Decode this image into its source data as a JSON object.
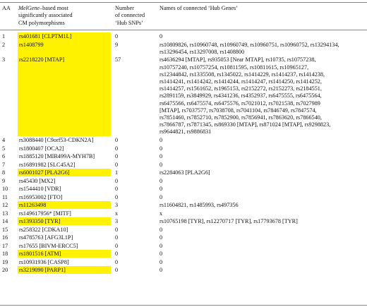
{
  "header": {
    "col_aa": "AA",
    "col_snp_em": "MelGene",
    "col_snp_rest1": "–based most",
    "col_snp_line2": "significantly associated",
    "col_snp_line3": "CM polymorphisms",
    "col_num_line1": "Number",
    "col_num_line2": "of connected",
    "col_num_line3": "‘Hub SNPs’",
    "col_names": "Names of connected ‘Hub Genes’"
  },
  "colors": {
    "highlight": "#fff200",
    "rule": "#888888"
  },
  "rows": [
    {
      "aa": "1",
      "snp": "rs401681 [CLPTM1L]",
      "highlight": true,
      "count": "0",
      "names": [
        "0"
      ]
    },
    {
      "aa": "2",
      "snp": "rs1408799",
      "highlight": true,
      "count": "9",
      "names": [
        "rs10809826, rs10960748, rs10960749, rs10960751, rs10960752, rs13294134,",
        "rs13296454, rs13297008, rs1408800"
      ]
    },
    {
      "aa": "3",
      "snp": "rs2218220 [MTAP]",
      "highlight": true,
      "count": "57",
      "names": [
        "rs4636294 [MTAP], rs935053 [Near MTAP], rs10735, rs10757238,",
        "rs10757240, rs10757254, rs10811595, rs10811615, rs10965127,",
        "rs12344842, rs1335508, rs1345022, rs1414229, rs1414237, rs1414238,",
        "rs1414241, rs1414242, rs1414244, rs1414247, rs1414250, rs1414252,",
        "rs1414257, rs1561652, rs1965153, rs2152272, rs2152273, rs2184551,",
        "rs2891159, rs3849929, rs4341236, rs4352937, rs6475555, rs6475564,",
        "rs6475566, rs6475574, rs6475576, rs7021012, rs7021538, rs7027989",
        "[MTAP], rs7037577, rs7038708, rs7041104, rs7846749, rs7847574,",
        "rs7851460, rs7852710, rs7852900, rs7856941, rs7863620, rs7866540,",
        "rs7866787, rs7871345, rs869330 [MTAP], rs871024 [MTAP], rs9298823,",
        "rs9644821, rs9886831"
      ]
    },
    {
      "aa": "4",
      "snp": "rs3088440 [C9orf53-CDKN2A]",
      "highlight": false,
      "count": "0",
      "names": [
        "0"
      ]
    },
    {
      "aa": "5",
      "snp": "rs1800407 [OCA2]",
      "highlight": false,
      "count": "0",
      "names": [
        "0"
      ]
    },
    {
      "aa": "6",
      "snp": "rs1885120 [MIR499A-MYH7B]",
      "highlight": false,
      "count": "0",
      "names": [
        "0"
      ]
    },
    {
      "aa": "7",
      "snp": "rs16891982 [SLC45A2]",
      "highlight": false,
      "count": "0",
      "names": [
        "0"
      ]
    },
    {
      "aa": "8",
      "snp": "rs6001027 [PLA2G6]",
      "highlight": true,
      "count": "1",
      "names": [
        "rs2284063 [PLA2G6]"
      ]
    },
    {
      "aa": "9",
      "snp": "rs45430 [MX2]",
      "highlight": false,
      "count": "0",
      "names": [
        "0"
      ]
    },
    {
      "aa": "10",
      "snp": "rs1544410 [VDR]",
      "highlight": false,
      "count": "0",
      "names": [
        "0"
      ]
    },
    {
      "aa": "11",
      "snp": "rs16953002 [FTO]",
      "highlight": false,
      "count": "0",
      "names": [
        "0"
      ]
    },
    {
      "aa": "12",
      "snp": "rs11263498",
      "highlight": true,
      "count": "3",
      "names": [
        "rs11604821, rs1485993, rs497356"
      ]
    },
    {
      "aa": "13",
      "snp": "rs149617956* [MITF]",
      "highlight": false,
      "count": "x",
      "names": [
        "x"
      ]
    },
    {
      "aa": "14",
      "snp": "rs1393350 [TYR]",
      "highlight": true,
      "count": "3",
      "names": [
        "rs10765198 [TYR], rs12270717 [TYR], rs17793678 [TYR]"
      ]
    },
    {
      "aa": "15",
      "snp": "rs258322 [CDKA10]",
      "highlight": false,
      "count": "0",
      "names": [
        "0"
      ]
    },
    {
      "aa": "16",
      "snp": "rs4785763 [AFG3L1P]",
      "highlight": false,
      "count": "0",
      "names": [
        "0"
      ]
    },
    {
      "aa": "17",
      "snp": "rs17655 [BIVM-ERCC5]",
      "highlight": false,
      "count": "0",
      "names": [
        "0"
      ]
    },
    {
      "aa": "18",
      "snp": "rs1801516 [ATM]",
      "highlight": true,
      "count": "0",
      "names": [
        "0"
      ]
    },
    {
      "aa": "19",
      "snp": "rs10931936 [CASP8]",
      "highlight": false,
      "count": "0",
      "names": [
        "0"
      ]
    },
    {
      "aa": "20",
      "snp": "rs3219090 [PARP1]",
      "highlight": true,
      "count": "0",
      "names": [
        "0"
      ]
    }
  ]
}
